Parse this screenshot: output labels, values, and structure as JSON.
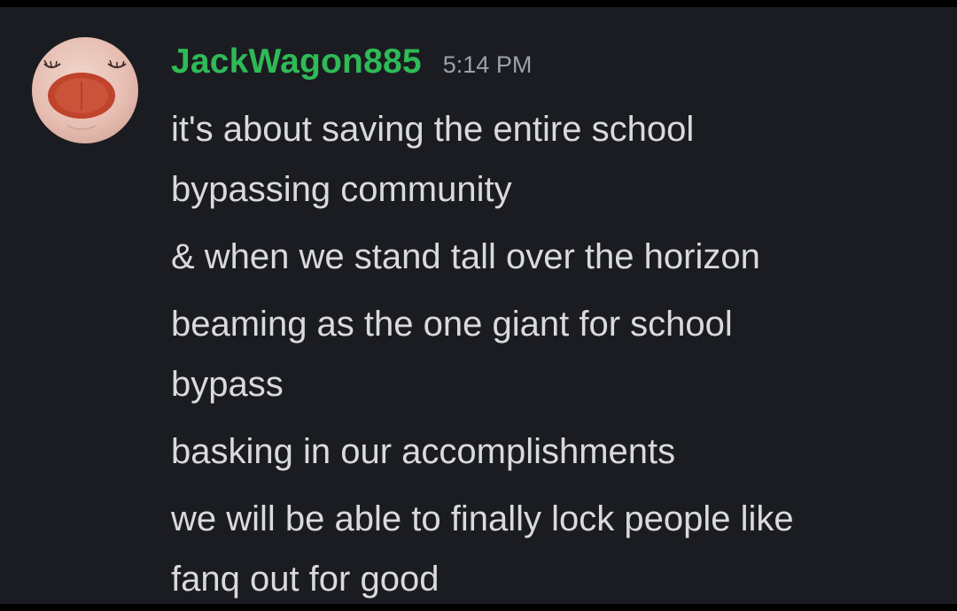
{
  "message": {
    "username": "JackWagon885",
    "timestamp": "5:14 PM",
    "avatar_icon": "smiling-face-avatar",
    "username_color": "#2fba56",
    "lines": [
      "it's about saving the entire school",
      "bypassing community",
      "& when we stand tall over the horizon",
      "beaming as the one giant for school",
      "bypass",
      "basking in our accomplishments",
      "we will be able to finally lock people like",
      "fanq out for good"
    ]
  }
}
